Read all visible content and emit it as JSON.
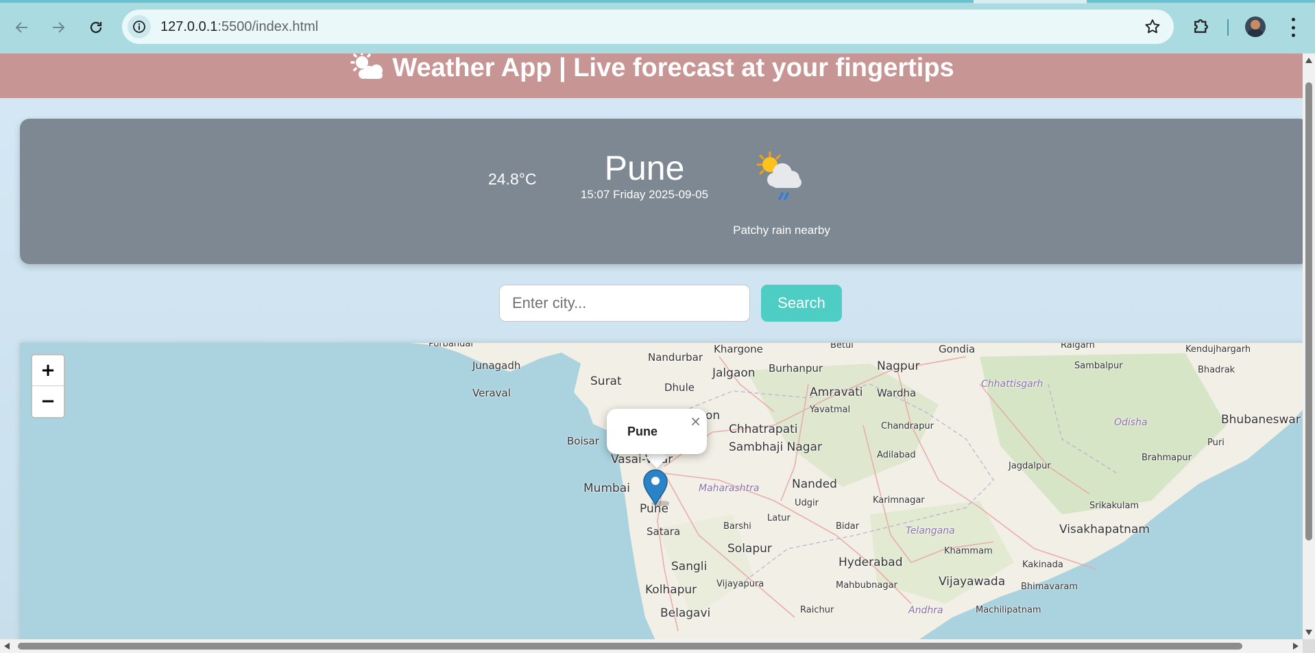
{
  "browser": {
    "url_host": "127.0.0.1",
    "url_path": ":5500/index.html",
    "icons": [
      "back-arrow-icon",
      "forward-arrow-icon",
      "reload-icon",
      "site-info-icon",
      "bookmark-star-icon",
      "extensions-puzzle-icon",
      "profile-avatar",
      "menu-dots-icon"
    ]
  },
  "header": {
    "icon": "sun-behind-cloud-icon",
    "title": "Weather App | Live forecast at your fingertips",
    "background": "#c89595"
  },
  "weather": {
    "temperature": "24.8°C",
    "city": "Pune",
    "datetime": "15:07 Friday 2025-09-05",
    "condition_icon": "patchy-rain-icon",
    "condition": "Patchy rain nearby",
    "card_color": "#7d8892"
  },
  "search": {
    "placeholder": "Enter city...",
    "value": "",
    "button_label": "Search",
    "button_color": "#4ecdc4"
  },
  "map": {
    "zoom_in_label": "+",
    "zoom_out_label": "−",
    "popup_text": "Pune",
    "popup_close": "×",
    "labels": {
      "porbandar": "Porbandar",
      "junagadh": "Junagadh",
      "veraval": "Veraval",
      "surat": "Surat",
      "nandurbar": "Nandurbar",
      "dhule": "Dhule",
      "khargone": "Khargone",
      "betul": "Betul",
      "jalgaon": "Jalgaon",
      "burhanpur": "Burhanpur",
      "nagpur": "Nagpur",
      "gondia": "Gondia",
      "raigarh": "Raigarh",
      "kendujhargarh": "Kendujhargarh",
      "sambalpur": "Sambalpur",
      "bhadrak": "Bhadrak",
      "amravati": "Amravati",
      "wardha": "Wardha",
      "chhattisgarh": "Chhattisgarh",
      "yavatmal": "Yavatmal",
      "nashik_partial": "on",
      "chhatrapati": "Chhatrapati",
      "sambhaji_nagar": "Sambhaji Nagar",
      "chandrapur": "Chandrapur",
      "odisha": "Odisha",
      "bhubaneswar": "Bhubaneswar",
      "boisar": "Boisar",
      "vasai_virar": "Vasai-Virar",
      "adilabad": "Adilabad",
      "brahmapur": "Brahmapur",
      "puri": "Puri",
      "jagdalpur": "Jagdalpur",
      "mumbai": "Mumbai",
      "maharashtra": "Maharashtra",
      "nanded": "Nanded",
      "pune": "Pune",
      "udgir": "Udgir",
      "karimnagar": "Karimnagar",
      "srikakulam": "Srikakulam",
      "satara": "Satara",
      "barshi": "Barshi",
      "latur": "Latur",
      "bidar": "Bidar",
      "telangana": "Telangana",
      "visakhapatnam": "Visakhapatnam",
      "khammam": "Khammam",
      "solapur": "Solapur",
      "sangli": "Sangli",
      "hyderabad": "Hyderabad",
      "kakinada": "Kakinada",
      "vijayawada": "Vijayawada",
      "kolhapur": "Kolhapur",
      "vijayapura": "Vijayapura",
      "mahbubnagar": "Mahbubnagar",
      "bhimavaram": "Bhimavaram",
      "belagavi": "Belagavi",
      "raichur": "Raichur",
      "andhra": "Andhra",
      "machilipatnam": "Machilipatnam"
    }
  }
}
